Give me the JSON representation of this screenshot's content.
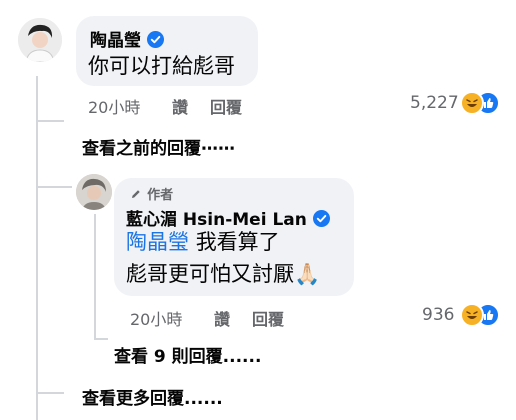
{
  "comment1": {
    "author": "陶晶瑩",
    "text": "你可以打給彪哥",
    "time": "20小時",
    "like_label": "讚",
    "reply_label": "回覆",
    "reaction_count": "5,227",
    "reactions": [
      "haha",
      "like"
    ]
  },
  "previous_replies_link": "查看之前的回覆⋯⋯",
  "reply1": {
    "author_badge": "作者",
    "author": "藍心湄 Hsin-Mei Lan",
    "mention": "陶晶瑩",
    "text_line1": "我看算了",
    "text_line2": "彪哥更可怕又討厭",
    "emoji": "🙏🏻",
    "time": "20小時",
    "like_label": "讚",
    "reply_label": "回覆",
    "reaction_count": "936",
    "reactions": [
      "haha",
      "like"
    ]
  },
  "view_replies_link": "查看 9 則回覆......",
  "view_more_link": "查看更多回覆......",
  "colors": {
    "mention": "#1b74e4",
    "verified": "#1877f2",
    "like": "#1877f2",
    "haha": "#f7b125"
  }
}
